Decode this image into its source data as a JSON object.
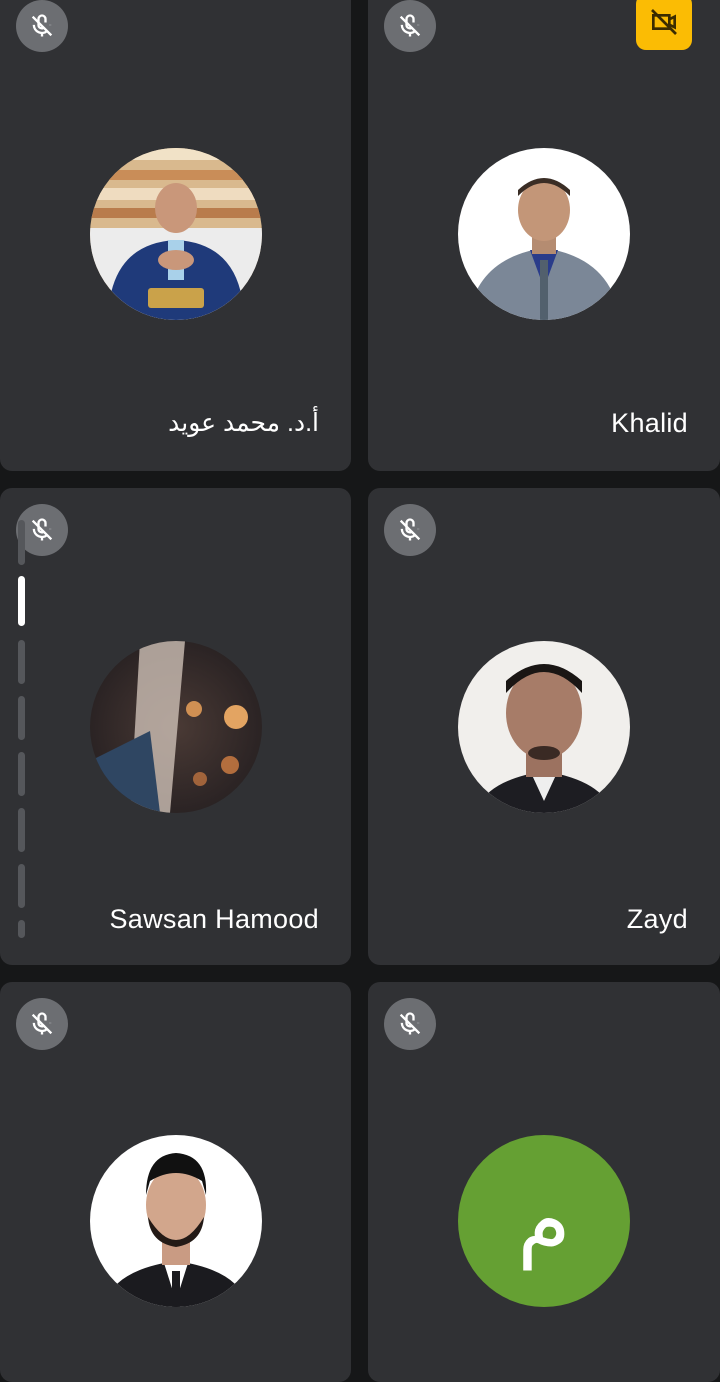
{
  "participants": [
    {
      "name": "أ.د. محمد عويد",
      "muted": true
    },
    {
      "name": "Khalid",
      "muted": true
    },
    {
      "name": "Sawsan Hamood",
      "muted": true
    },
    {
      "name": "Zayd",
      "muted": true
    },
    {
      "name": "",
      "muted": true
    },
    {
      "name": "",
      "muted": true,
      "initial": "م",
      "avatar_color": "#65a033"
    }
  ],
  "icons": {
    "mic_off": "mic-off-icon",
    "camera_off_badge": "video-off-icon"
  },
  "colors": {
    "background": "#161718",
    "tile": "#303134",
    "badge": "#fbbc04",
    "green_avatar": "#65a033"
  }
}
